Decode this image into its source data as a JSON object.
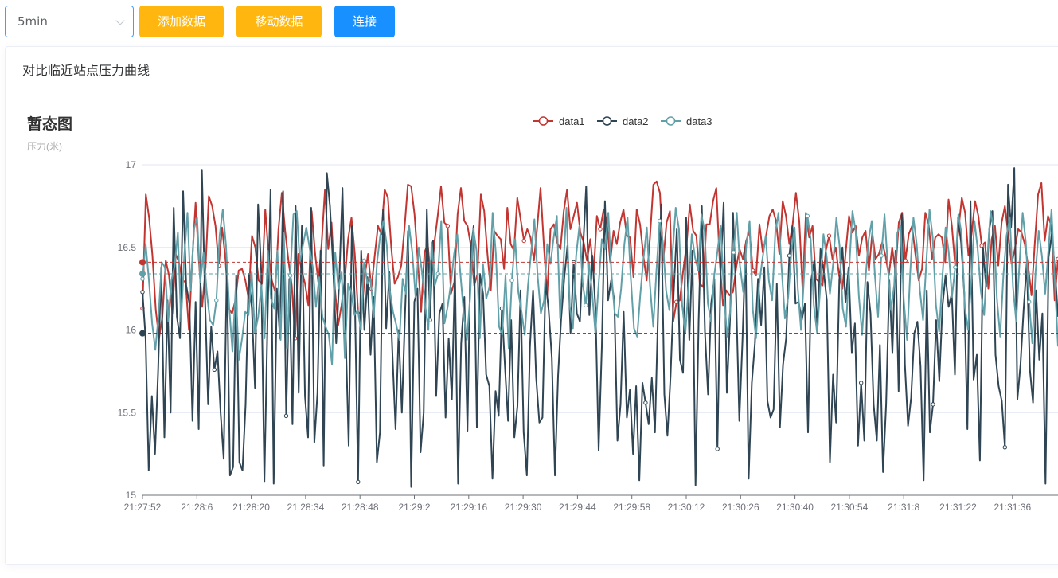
{
  "toolbar": {
    "interval_select": "5min",
    "add_button": "添加数据",
    "move_button": "移动数据",
    "connect_button": "连接"
  },
  "card": {
    "title": "对比临近站点压力曲线"
  },
  "colors": {
    "data1": "#c23531",
    "data2": "#2f4554",
    "data3": "#61a0a8",
    "primary": "#1890ff",
    "warning": "#ffb70f"
  },
  "chart_data": {
    "type": "line",
    "title": "暂态图",
    "ylabel": "压力(米)",
    "ylim": [
      15,
      17
    ],
    "yticks": [
      15,
      15.5,
      16,
      16.5,
      17
    ],
    "legend_position": "top-center",
    "grid": "horizontal",
    "x_tick_labels": [
      "21:27:52",
      "21:28:6",
      "21:28:20",
      "21:28:34",
      "21:28:48",
      "21:29:2",
      "21:29:16",
      "21:29:30",
      "21:29:44",
      "21:29:58",
      "21:30:12",
      "21:30:26",
      "21:30:40",
      "21:30:54",
      "21:31:8",
      "21:31:22",
      "21:31:36"
    ],
    "series": [
      {
        "name": "data1",
        "mean": 16.41,
        "values": [
          16.13,
          16.82,
          16.68,
          16.45,
          16.12,
          15.95,
          16.08,
          16.42,
          16.33,
          16.1,
          16.46,
          16.41,
          16.3,
          16.29,
          16.0,
          16.42,
          16.77,
          16.42,
          16.14,
          16.38,
          16.81,
          16.75,
          16.63,
          16.39,
          16.62,
          16.43,
          16.13,
          16.1,
          16.18,
          16.36,
          16.37,
          16.3,
          16.19,
          16.57,
          16.5,
          16.3,
          16.28,
          16.73,
          16.46,
          16.3,
          16.23,
          16.61,
          16.83,
          16.6,
          16.42,
          16.27,
          15.95,
          16.46,
          16.36,
          16.28,
          16.15,
          16.72,
          16.47,
          16.29,
          16.52,
          16.85,
          16.49,
          16.65,
          16.25,
          16.03,
          16.15,
          16.31,
          16.55,
          16.68,
          16.46,
          16.11,
          16.09,
          16.33,
          16.46,
          16.25,
          16.45,
          16.63,
          16.58,
          16.85,
          16.8,
          16.5,
          16.28,
          16.32,
          16.39,
          16.62,
          16.88,
          16.87,
          16.7,
          16.42,
          16.11,
          16.47,
          16.52,
          16.3,
          16.53,
          16.69,
          16.87,
          16.65,
          16.63,
          16.22,
          16.29,
          16.7,
          16.86,
          16.66,
          16.63,
          16.51,
          16.27,
          16.34,
          16.82,
          16.72,
          16.46,
          16.24,
          16.6,
          16.57,
          16.55,
          16.37,
          16.74,
          16.52,
          16.48,
          16.8,
          16.67,
          16.54,
          16.61,
          16.56,
          16.42,
          16.62,
          16.86,
          16.51,
          16.21,
          16.61,
          16.64,
          16.53,
          16.49,
          16.72,
          16.85,
          16.61,
          16.69,
          16.77,
          16.59,
          16.53,
          16.42,
          16.55,
          16.34,
          16.69,
          16.61,
          16.73,
          16.66,
          16.41,
          16.6,
          16.52,
          16.65,
          16.73,
          16.57,
          16.56,
          16.32,
          16.73,
          16.64,
          16.45,
          16.3,
          16.56,
          16.88,
          16.9,
          16.83,
          16.42,
          16.65,
          16.72,
          16.05,
          16.17,
          16.18,
          16.36,
          16.51,
          16.76,
          16.6,
          16.57,
          16.28,
          16.26,
          16.64,
          16.64,
          16.78,
          16.86,
          16.42,
          16.15,
          16.24,
          16.21,
          16.23,
          16.38,
          16.49,
          16.43,
          16.54,
          16.6,
          16.36,
          16.33,
          16.64,
          16.47,
          16.57,
          16.69,
          16.73,
          16.66,
          16.46,
          16.78,
          16.69,
          16.52,
          16.64,
          16.83,
          16.66,
          16.24,
          16.71,
          16.56,
          16.63,
          16.31,
          16.29,
          16.27,
          16.48,
          16.57,
          16.43,
          16.5,
          16.33,
          16.25,
          16.47,
          16.69,
          16.59,
          16.63,
          16.45,
          16.56,
          16.6,
          16.36,
          16.59,
          16.43,
          16.46,
          16.53,
          16.45,
          16.33,
          16.5,
          16.35,
          16.65,
          16.71,
          16.42,
          16.58,
          16.63,
          16.46,
          16.3,
          16.37,
          16.71,
          16.64,
          16.43,
          16.56,
          16.58,
          16.56,
          16.41,
          16.79,
          16.63,
          16.39,
          16.61,
          16.8,
          16.71,
          16.45,
          16.59,
          16.78,
          16.69,
          16.51,
          16.53,
          16.25,
          16.55,
          16.63,
          16.39,
          16.65,
          16.75,
          16.58,
          16.4,
          16.49,
          16.61,
          16.59,
          16.52,
          16.39,
          16.21,
          16.52,
          16.82,
          16.89,
          16.54,
          16.69,
          16.63,
          16.18,
          16.43
        ]
      },
      {
        "name": "data2",
        "mean": 15.98,
        "values": [
          16.23,
          15.95,
          15.15,
          15.6,
          15.25,
          15.75,
          16.38,
          15.35,
          16.18,
          15.5,
          16.74,
          16.08,
          15.95,
          16.84,
          16.27,
          16.16,
          15.45,
          16.17,
          15.4,
          16.97,
          16.2,
          15.55,
          16.02,
          15.76,
          15.87,
          15.5,
          15.22,
          16.4,
          15.12,
          15.17,
          16.33,
          15.2,
          15.15,
          15.55,
          16.34,
          16.13,
          15.65,
          16.76,
          16.36,
          15.08,
          16.05,
          16.85,
          15.07,
          16.25,
          15.95,
          16.84,
          15.48,
          16.31,
          15.43,
          16.75,
          15.62,
          16.63,
          15.6,
          15.35,
          16.74,
          15.32,
          15.62,
          16.48,
          15.18,
          16.95,
          16.75,
          16.39,
          15.92,
          16.32,
          16.86,
          16.0,
          15.3,
          16.63,
          16.15,
          15.08,
          16.48,
          16.0,
          16.32,
          15.85,
          16.2,
          15.2,
          15.38,
          16.73,
          16.01,
          16.35,
          15.85,
          15.4,
          16.0,
          15.5,
          16.09,
          16.6,
          15.05,
          16.17,
          16.25,
          15.26,
          15.5,
          16.73,
          16.06,
          16.54,
          15.6,
          16.1,
          16.16,
          15.47,
          15.95,
          15.58,
          16.37,
          15.07,
          15.92,
          16.2,
          15.39,
          16.47,
          16.63,
          15.41,
          16.34,
          16.22,
          15.73,
          15.66,
          15.1,
          15.63,
          15.48,
          16.13,
          15.78,
          15.45,
          16.06,
          15.35,
          15.54,
          16.24,
          15.38,
          15.12,
          15.9,
          16.24,
          15.71,
          15.44,
          15.47,
          16.3,
          16.12,
          15.83,
          15.12,
          15.72,
          16.07,
          16.32,
          16.51,
          15.98,
          16.41,
          16.1,
          16.05,
          16.49,
          16.87,
          16.09,
          16.45,
          16.12,
          15.27,
          15.9,
          16.78,
          16.18,
          16.3,
          16.18,
          15.33,
          15.55,
          16.11,
          15.47,
          15.64,
          15.25,
          15.66,
          15.09,
          15.68,
          15.56,
          15.43,
          15.71,
          15.38,
          16.11,
          16.76,
          15.61,
          15.36,
          15.72,
          16.22,
          16.61,
          15.82,
          15.74,
          16.68,
          15.94,
          16.48,
          15.06,
          16.06,
          16.75,
          15.99,
          15.61,
          16.16,
          16.31,
          15.28,
          16.33,
          16.77,
          15.62,
          16.05,
          16.71,
          16.2,
          15.45,
          15.93,
          16.5,
          15.1,
          15.68,
          15.92,
          16.31,
          16.03,
          16.38,
          15.57,
          15.47,
          15.52,
          16.28,
          15.41,
          15.79,
          15.95,
          16.45,
          16.63,
          16.16,
          16.17,
          16.06,
          16.16,
          15.38,
          16.3,
          16.42,
          15.99,
          16.49,
          16.36,
          16.18,
          15.2,
          15.73,
          15.44,
          16.3,
          16.5,
          16.17,
          16.38,
          15.86,
          16.04,
          15.3,
          15.68,
          15.33,
          16.29,
          16.1,
          15.55,
          15.33,
          15.91,
          15.14,
          15.55,
          16.3,
          15.86,
          16.48,
          15.63,
          16.7,
          15.79,
          15.42,
          15.59,
          15.98,
          16.05,
          15.78,
          15.09,
          16.24,
          15.38,
          15.55,
          16.06,
          15.69,
          16.14,
          16.33,
          16.14,
          16.22,
          15.73,
          16.68,
          16.53,
          16.22,
          15.4,
          16.78,
          15.7,
          15.85,
          15.21,
          16.5,
          16.26,
          16.61,
          16.72,
          15.85,
          15.66,
          15.57,
          15.29,
          16.88,
          16.62,
          16.98,
          15.58,
          15.79,
          16.12,
          16.41,
          15.76,
          15.56,
          16.24,
          15.82,
          16.1,
          15.07,
          16.44,
          16.58,
          16.37,
          16.08
        ]
      },
      {
        "name": "data3",
        "mean": 16.34,
        "values": [
          16.31,
          16.52,
          16.3,
          16.04,
          15.88,
          16.09,
          16.41,
          16.38,
          16.05,
          16.3,
          16.39,
          16.59,
          16.05,
          16.45,
          16.71,
          16.24,
          16.61,
          16.68,
          16.29,
          16.47,
          16.23,
          16.06,
          16.03,
          16.18,
          16.57,
          16.73,
          16.51,
          16.14,
          15.87,
          16.25,
          15.82,
          15.95,
          16.11,
          16.09,
          16.35,
          15.98,
          16.08,
          16.27,
          15.95,
          16.48,
          16.19,
          16.13,
          16.48,
          15.94,
          16.59,
          15.89,
          16.33,
          16.7,
          16.72,
          16.41,
          16.52,
          16.62,
          16.5,
          16.38,
          16.14,
          16.32,
          16.08,
          16.02,
          15.97,
          15.79,
          16.47,
          16.25,
          16.35,
          15.83,
          16.28,
          16.23,
          16.09,
          16.12,
          16.0,
          16.42,
          16.28,
          16.31,
          16.08,
          16.41,
          16.57,
          16.66,
          16.52,
          16.24,
          16.11,
          16.03,
          15.94,
          16.31,
          16.22,
          16.63,
          16.47,
          16.2,
          16.5,
          16.35,
          16.15,
          16.0,
          16.53,
          16.27,
          16.34,
          16.66,
          16.04,
          16.14,
          16.28,
          16.46,
          16.58,
          16.33,
          16.1,
          15.94,
          16.2,
          16.61,
          16.48,
          15.95,
          16.4,
          16.19,
          16.26,
          16.71,
          16.46,
          16.02,
          15.97,
          16.33,
          15.89,
          16.3,
          16.55,
          16.23,
          16.11,
          15.97,
          16.27,
          16.47,
          16.67,
          16.33,
          16.1,
          16.18,
          16.52,
          16.4,
          16.56,
          16.69,
          16.07,
          16.38,
          16.74,
          16.14,
          16.01,
          16.45,
          16.63,
          16.29,
          16.15,
          16.41,
          16.22,
          15.98,
          16.28,
          16.55,
          16.49,
          16.71,
          16.34,
          16.1,
          16.08,
          16.25,
          16.52,
          16.68,
          16.32,
          16.01,
          15.96,
          16.22,
          16.44,
          16.62,
          16.27,
          16.02,
          16.36,
          16.66,
          16.53,
          16.24,
          16.12,
          16.46,
          16.74,
          16.61,
          16.15,
          15.98,
          16.27,
          16.58,
          16.44,
          16.36,
          16.7,
          16.6,
          16.16,
          16.05,
          16.33,
          16.48,
          16.63,
          16.22,
          15.96,
          16.12,
          16.47,
          16.71,
          16.39,
          16.23,
          16.52,
          16.66,
          16.12,
          15.95,
          16.28,
          16.43,
          16.57,
          16.3,
          16.18,
          16.59,
          16.71,
          16.36,
          16.07,
          16.2,
          16.48,
          16.62,
          16.25,
          16.0,
          16.34,
          16.69,
          16.55,
          16.15,
          15.98,
          16.26,
          16.58,
          16.44,
          16.22,
          16.4,
          16.68,
          16.51,
          16.13,
          16.02,
          16.37,
          16.72,
          16.6,
          16.21,
          15.97,
          16.29,
          16.54,
          16.66,
          16.33,
          16.08,
          16.45,
          16.7,
          16.39,
          16.12,
          16.27,
          16.59,
          16.63,
          16.18,
          15.94,
          16.35,
          16.68,
          16.52,
          16.24,
          16.06,
          16.41,
          16.73,
          16.56,
          16.15,
          15.99,
          16.31,
          16.62,
          16.47,
          16.2,
          16.38,
          16.7,
          16.58,
          16.14,
          16.0,
          16.3,
          16.66,
          16.49,
          16.23,
          16.09,
          16.44,
          16.72,
          16.61,
          16.19,
          15.96,
          16.33,
          16.57,
          16.68,
          16.26,
          16.05,
          16.4,
          16.71,
          16.53,
          16.17,
          15.92,
          16.35,
          16.6,
          16.45,
          16.22,
          16.48,
          16.73,
          16.3,
          15.9
        ]
      }
    ]
  }
}
